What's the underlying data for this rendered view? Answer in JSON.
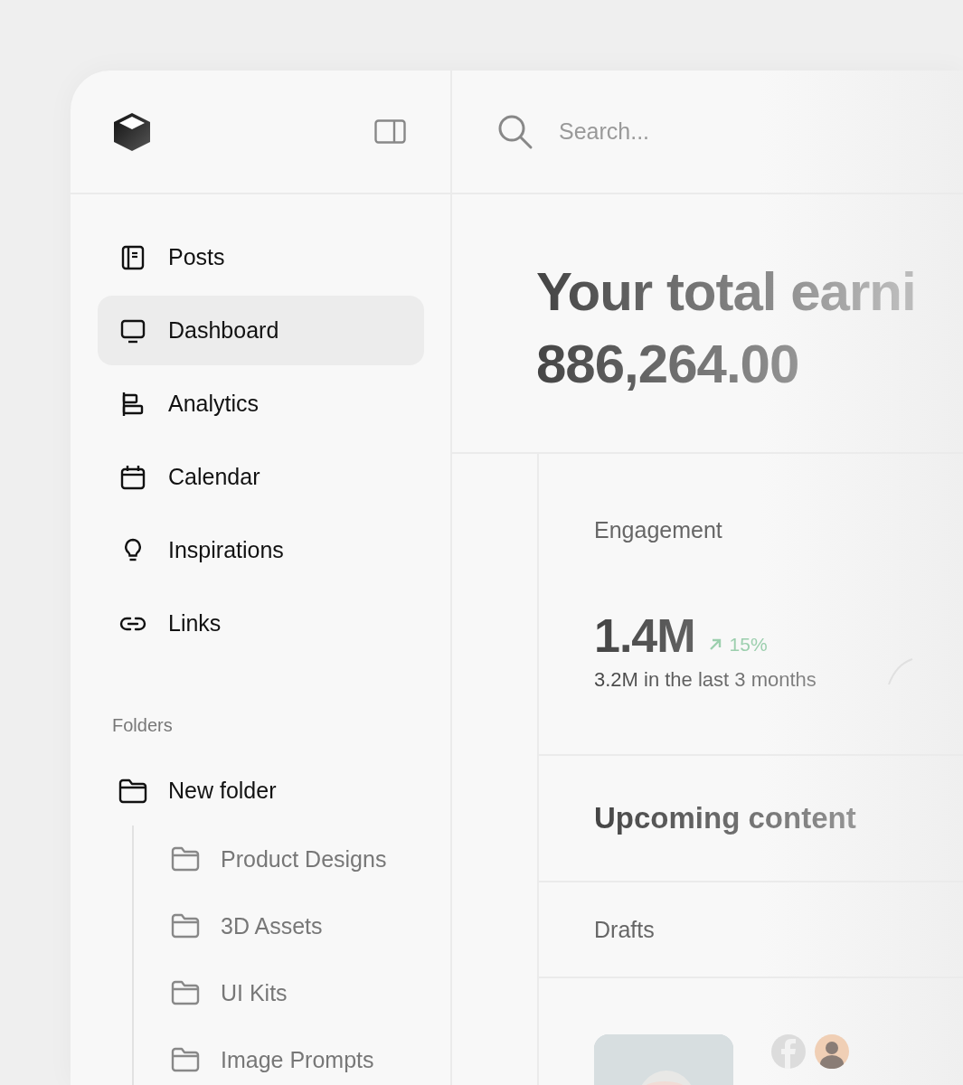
{
  "sidebar": {
    "nav": [
      {
        "label": "Posts",
        "selected": false
      },
      {
        "label": "Dashboard",
        "selected": true
      },
      {
        "label": "Analytics",
        "selected": false
      },
      {
        "label": "Calendar",
        "selected": false
      },
      {
        "label": "Inspirations",
        "selected": false
      },
      {
        "label": "Links",
        "selected": false
      }
    ],
    "folders_label": "Folders",
    "folders": [
      {
        "label": "New folder",
        "children": [
          {
            "label": "Product Designs"
          },
          {
            "label": "3D Assets"
          },
          {
            "label": "UI Kits"
          },
          {
            "label": "Image Prompts"
          }
        ]
      }
    ]
  },
  "search": {
    "placeholder": "Search..."
  },
  "earnings": {
    "title": "Your total earni",
    "amount": "886,264.00"
  },
  "engagement": {
    "title": "Engagement",
    "value": "1.4M",
    "change": "15%",
    "subtitle": "3.2M in the last 3 months"
  },
  "upcoming": {
    "title": "Upcoming content"
  },
  "drafts": {
    "title": "Drafts"
  }
}
